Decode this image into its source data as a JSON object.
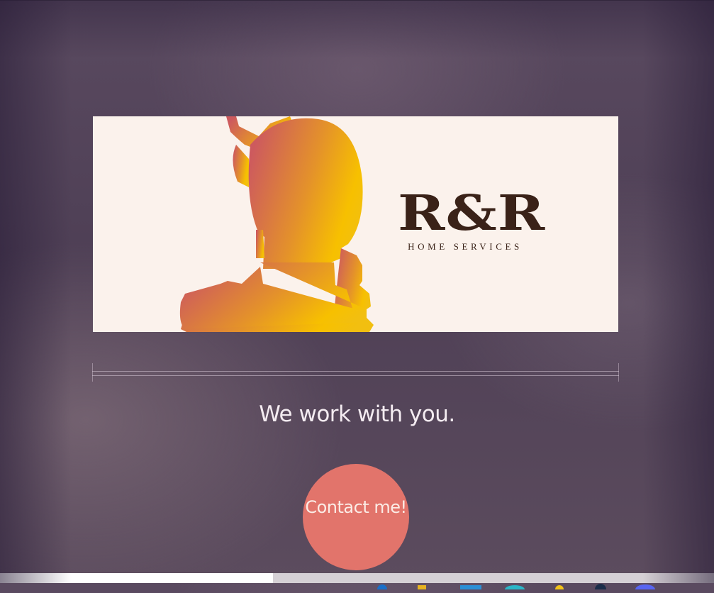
{
  "banner": {
    "brand_name": "R&R",
    "brand_tagline": "HOME SERVICES",
    "logo_icon": "miter-saw-icon",
    "colors": {
      "background": "#fbf2ec",
      "text": "#3a2218",
      "gradient_start": "#cd5a5e",
      "gradient_end": "#f7c000"
    }
  },
  "main": {
    "tagline": "We work with you.",
    "contact_button_label": "Contact me!",
    "accent_color": "#e2746b"
  },
  "taskbar": {
    "icons": [
      "edge-icon",
      "file-explorer-icon",
      "store-icon",
      "edge-alt-icon",
      "chrome-icon",
      "steam-icon",
      "discord-icon"
    ]
  }
}
